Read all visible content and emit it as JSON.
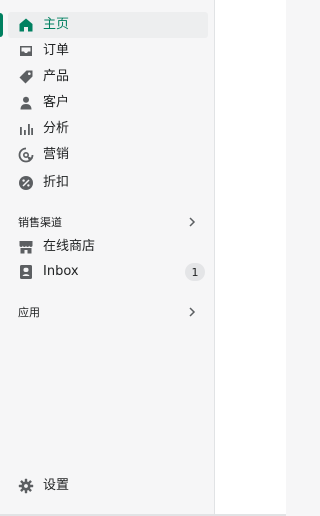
{
  "nav": {
    "items": [
      {
        "label": "主页",
        "icon": "home-icon",
        "active": true
      },
      {
        "label": "订单",
        "icon": "inbox-tray-icon"
      },
      {
        "label": "产品",
        "icon": "tag-icon"
      },
      {
        "label": "客户",
        "icon": "person-icon"
      },
      {
        "label": "分析",
        "icon": "bar-chart-icon"
      },
      {
        "label": "营销",
        "icon": "target-pointer-icon"
      },
      {
        "label": "折扣",
        "icon": "discount-icon"
      }
    ]
  },
  "sales_channels": {
    "header": "销售渠道",
    "items": [
      {
        "label": "在线商店",
        "icon": "storefront-icon"
      },
      {
        "label": "Inbox",
        "icon": "inbox-app-icon",
        "badge": "1"
      }
    ]
  },
  "apps": {
    "header": "应用"
  },
  "footer": {
    "settings_label": "设置",
    "icon": "gear-icon"
  },
  "colors": {
    "accent": "#008060",
    "text": "#202223",
    "icon": "#5c5f62",
    "sidebar_bg": "#f6f6f7"
  }
}
